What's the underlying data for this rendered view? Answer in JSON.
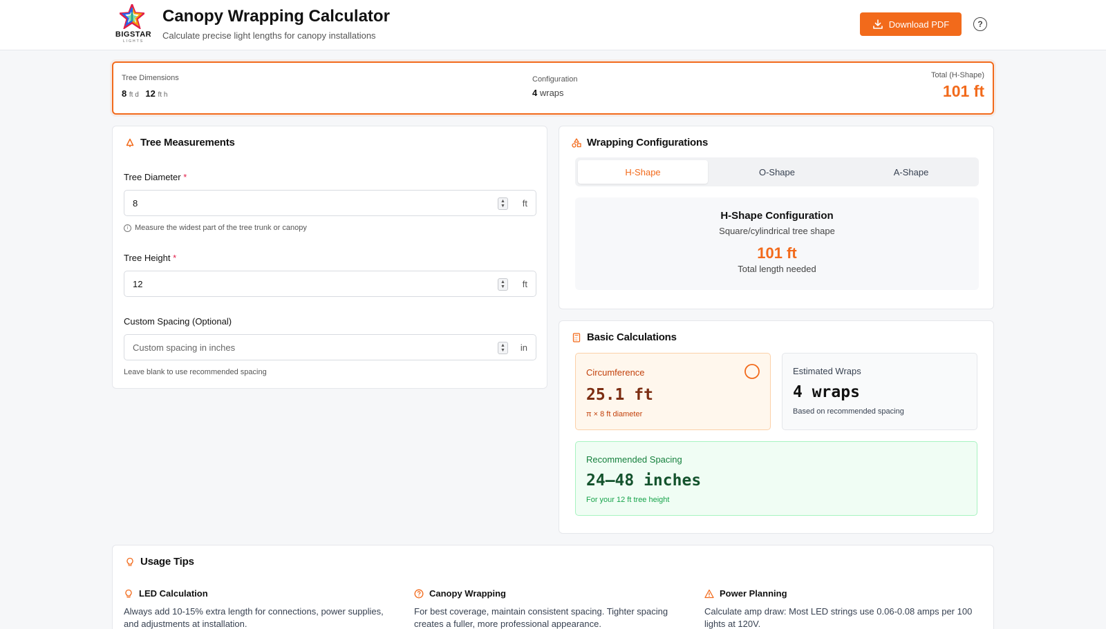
{
  "header": {
    "logo_text": "BIGSTAR",
    "logo_sub": "LIGHTS",
    "title": "Canopy Wrapping Calculator",
    "subtitle": "Calculate precise light lengths for canopy installations",
    "download_label": "Download PDF",
    "help_label": "?"
  },
  "summary": {
    "dimensions_label": "Tree Dimensions",
    "diameter": "8",
    "diameter_unit": "ft d",
    "height": "12",
    "height_unit": "ft h",
    "configuration_label": "Configuration",
    "wraps": "4",
    "wraps_unit": "wraps",
    "total_label": "Total (H-Shape)",
    "total_value": "101 ft"
  },
  "measurements": {
    "title": "Tree Measurements",
    "diameter_label": "Tree Diameter",
    "diameter_value": "8",
    "diameter_unit": "ft",
    "diameter_hint": "Measure the widest part of the tree trunk or canopy",
    "height_label": "Tree Height",
    "height_value": "12",
    "height_unit": "ft",
    "spacing_label": "Custom Spacing (Optional)",
    "spacing_placeholder": "Custom spacing in inches",
    "spacing_unit": "in",
    "spacing_hint": "Leave blank to use recommended spacing",
    "required_mark": "*"
  },
  "configurations": {
    "title": "Wrapping Configurations",
    "tabs": [
      "H-Shape",
      "O-Shape",
      "A-Shape"
    ],
    "active_tab": "H-Shape",
    "panel_title": "H-Shape Configuration",
    "panel_subtitle": "Square/cylindrical tree shape",
    "panel_value": "101 ft",
    "panel_caption": "Total length needed"
  },
  "calculations": {
    "title": "Basic Calculations",
    "circumference_label": "Circumference",
    "circumference_value": "25.1 ft",
    "circumference_note": "π × 8 ft diameter",
    "wraps_label": "Estimated Wraps",
    "wraps_value": "4 wraps",
    "wraps_note": "Based on recommended spacing",
    "spacing_label": "Recommended Spacing",
    "spacing_value": "24–48 inches",
    "spacing_note": "For your 12 ft tree height"
  },
  "tips": {
    "title": "Usage Tips",
    "items": [
      {
        "title": "LED Calculation",
        "text": "Always add 10-15% extra length for connections, power supplies, and adjustments at installation."
      },
      {
        "title": "Canopy Wrapping",
        "text": "For best coverage, maintain consistent spacing. Tighter spacing creates a fuller, more professional appearance."
      },
      {
        "title": "Power Planning",
        "text": "Calculate amp draw: Most LED strings use 0.06-0.08 amps per 100 lights at 120V."
      }
    ]
  },
  "colors": {
    "accent": "#f26a1b",
    "success": "#16a34a",
    "success_bg": "#f0fdf4",
    "warn_bg": "#fff7ed"
  }
}
